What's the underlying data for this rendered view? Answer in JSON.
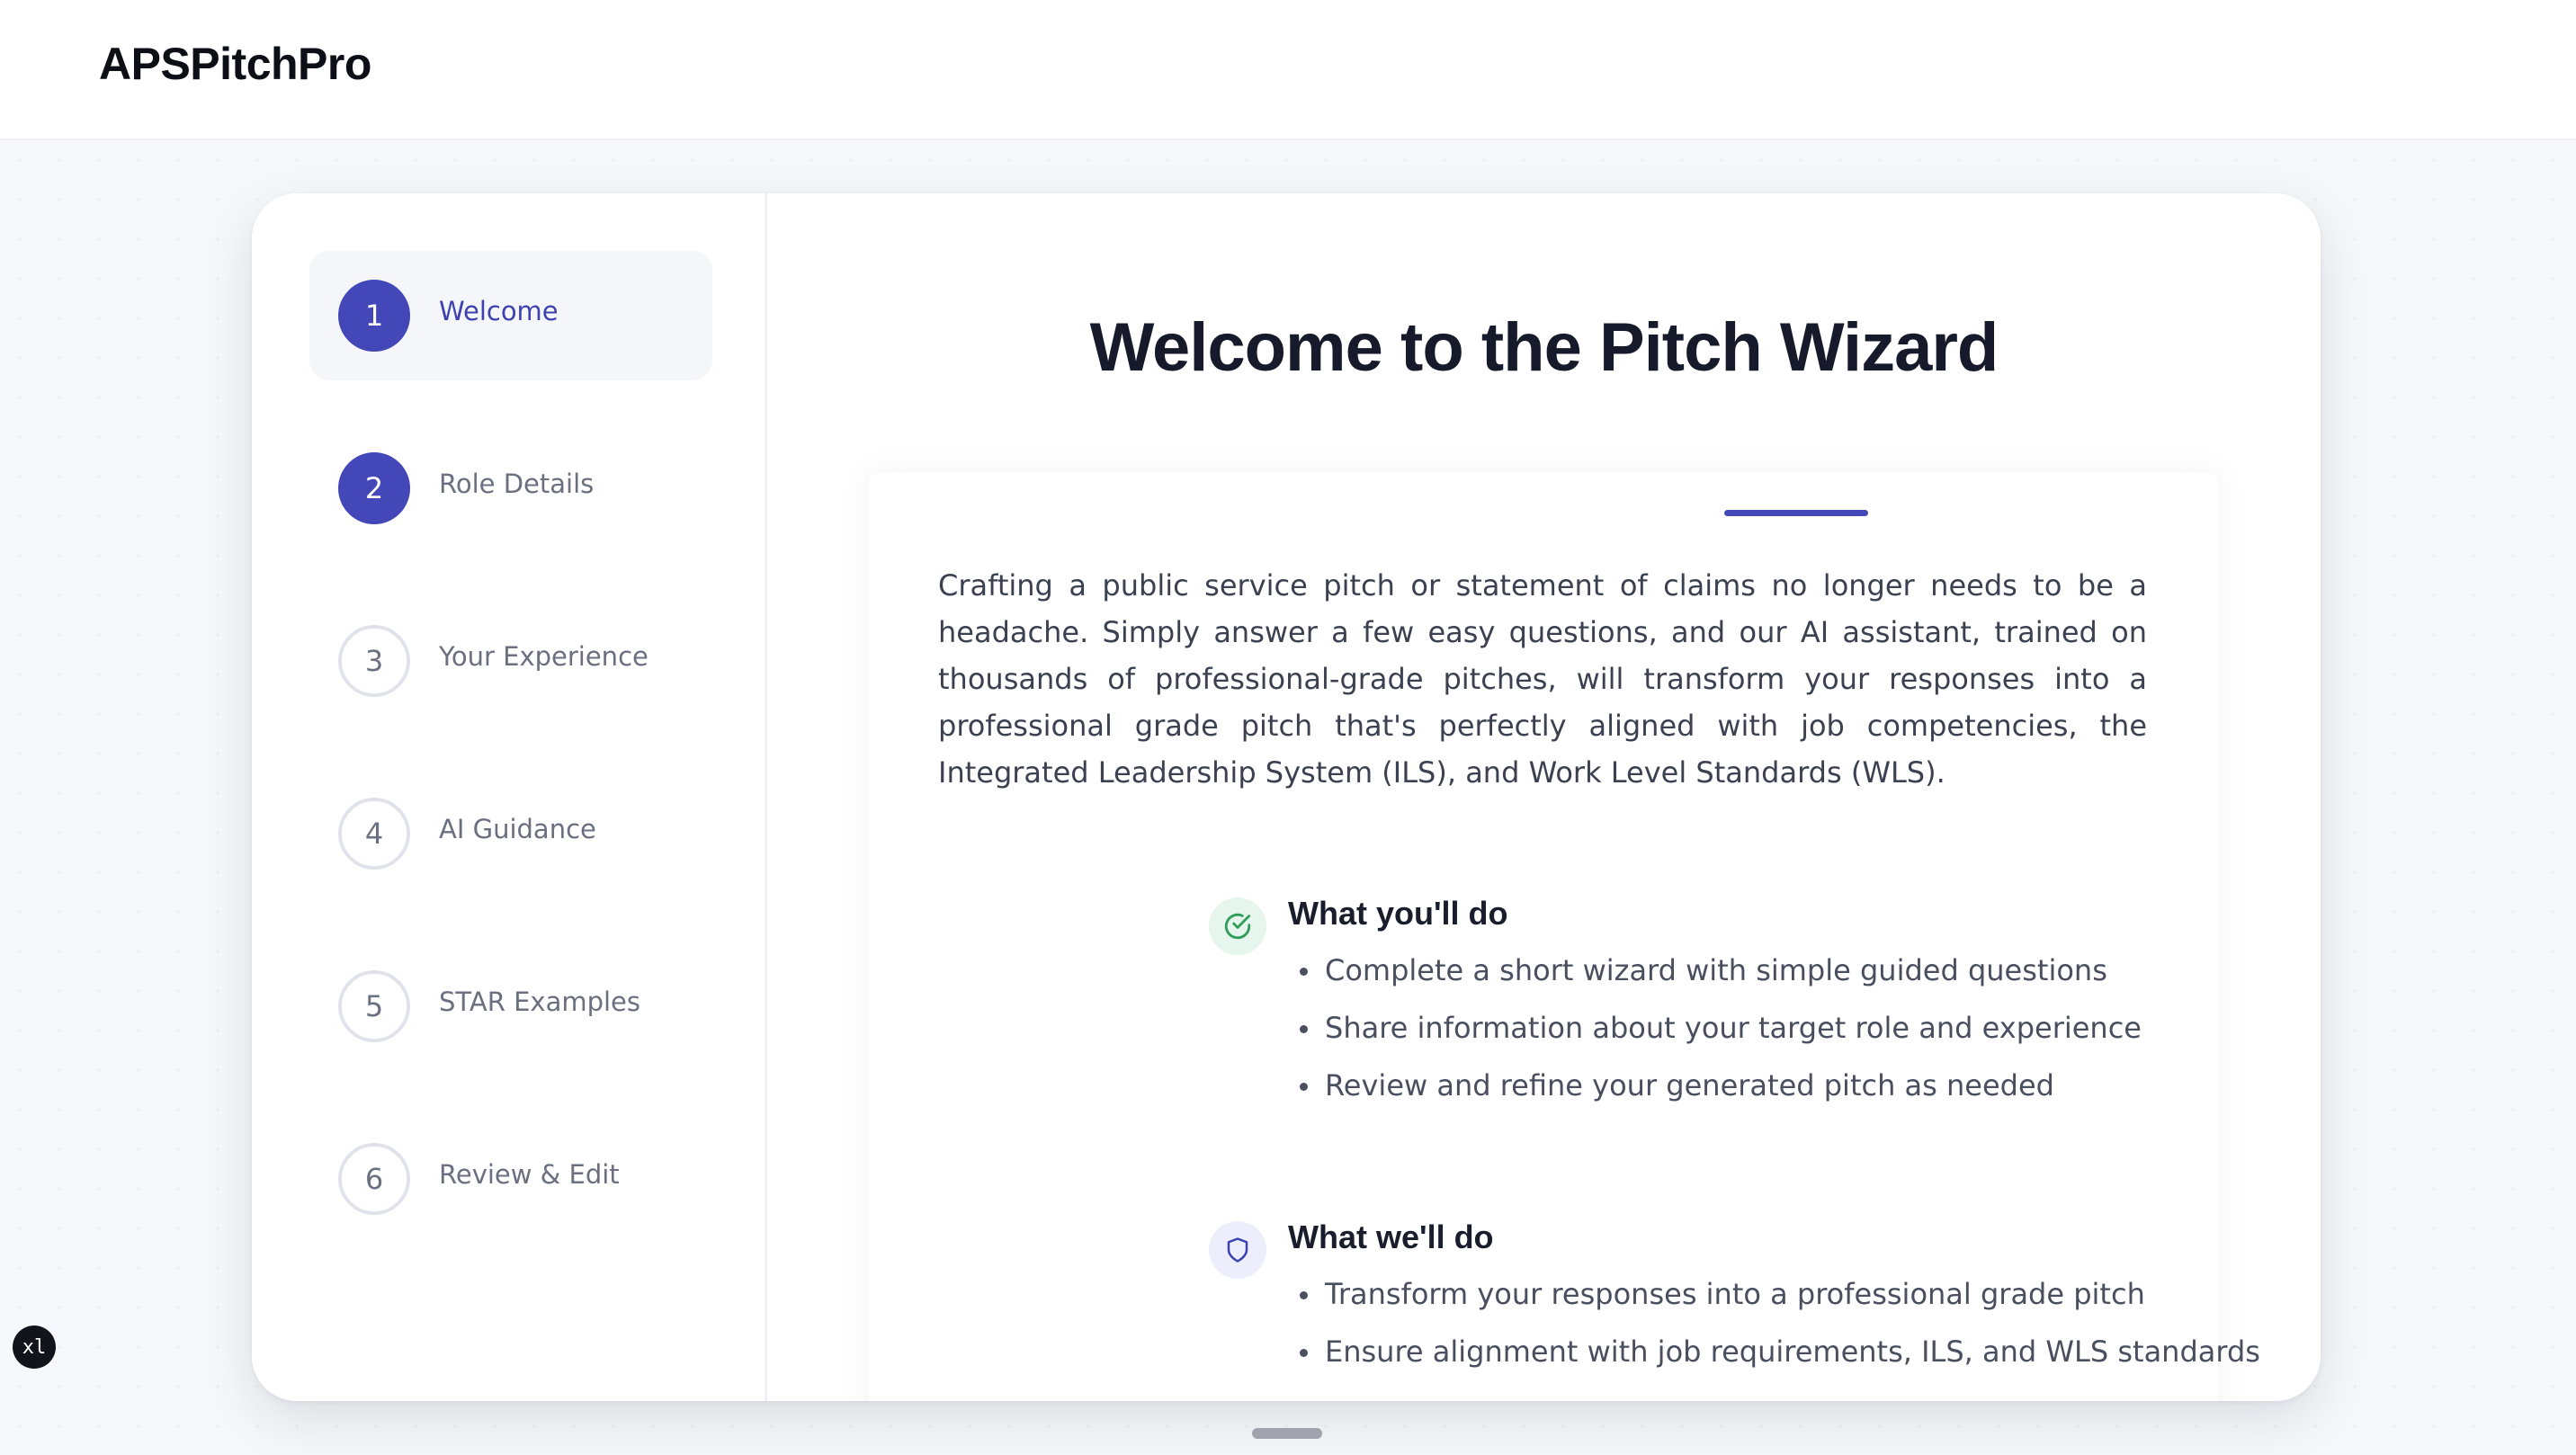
{
  "app": {
    "title": "APSPitchPro"
  },
  "steps": [
    {
      "number": "1",
      "label": "Welcome",
      "state": "active"
    },
    {
      "number": "2",
      "label": "Role Details",
      "state": "filled"
    },
    {
      "number": "3",
      "label": "Your Experience",
      "state": "pending"
    },
    {
      "number": "4",
      "label": "AI Guidance",
      "state": "pending"
    },
    {
      "number": "5",
      "label": "STAR Examples",
      "state": "pending"
    },
    {
      "number": "6",
      "label": "Review & Edit",
      "state": "pending"
    }
  ],
  "main": {
    "title": "Welcome to the Pitch Wizard",
    "intro": "Crafting a public service pitch or statement of claims no longer needs to be a headache. Simply answer a few easy questions, and our AI assistant, trained on thousands of professional-grade pitches, will transform your responses into a professional grade pitch that's perfectly aligned with job competencies, the Integrated Leadership System (ILS), and Work Level Standards (WLS).",
    "sections": [
      {
        "title": "What you'll do",
        "icon": "check-circle-icon",
        "items": [
          "Complete a short wizard with simple guided questions",
          "Share information about your target role and experience",
          "Review and refine your generated pitch as needed"
        ]
      },
      {
        "title": "What we'll do",
        "icon": "shield-icon",
        "items": [
          "Transform your responses into a professional grade pitch",
          "Ensure alignment with job requirements, ILS, and WLS standards"
        ]
      }
    ]
  },
  "dev_badge": "xl",
  "colors": {
    "accent": "#4347b8",
    "success_bg": "#e6f6ec",
    "success": "#2f9e5a",
    "info_bg": "#eceefc"
  }
}
